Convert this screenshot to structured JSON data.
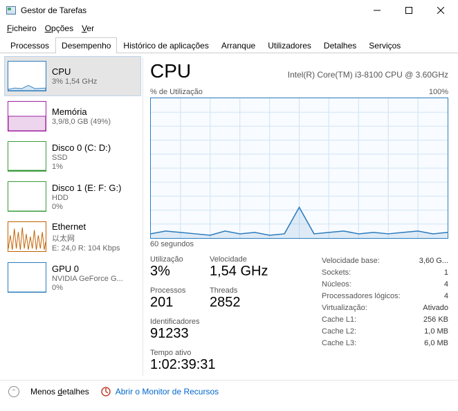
{
  "window": {
    "title": "Gestor de Tarefas"
  },
  "menu": {
    "file": "Ficheiro",
    "options": "Opções",
    "view": "Ver"
  },
  "tabs": [
    "Processos",
    "Desempenho",
    "Histórico de aplicações",
    "Arranque",
    "Utilizadores",
    "Detalhes",
    "Serviços"
  ],
  "active_tab_index": 1,
  "sidebar": [
    {
      "title": "CPU",
      "sub1": "3% 1,54 GHz",
      "sub2": "",
      "color": "#2a7bbd"
    },
    {
      "title": "Memória",
      "sub1": "3,9/8,0 GB (49%)",
      "sub2": "",
      "color": "#a020a0"
    },
    {
      "title": "Disco 0 (C: D:)",
      "sub1": "SSD",
      "sub2": "1%",
      "color": "#3a9a3a"
    },
    {
      "title": "Disco 1 (E: F: G:)",
      "sub1": "HDD",
      "sub2": "0%",
      "color": "#3a9a3a"
    },
    {
      "title": "Ethernet",
      "sub1": "以太网",
      "sub2": "E: 24,0 R: 104 Kbps",
      "color": "#c06000"
    },
    {
      "title": "GPU 0",
      "sub1": "NVIDIA GeForce G...",
      "sub2": "0%",
      "color": "#2a7bbd"
    }
  ],
  "main": {
    "title": "CPU",
    "model": "Intel(R) Core(TM) i3-8100 CPU @ 3.60GHz",
    "chart_label_left": "% de Utilização",
    "chart_label_right": "100%",
    "chart_bottom": "60 segundos",
    "stats": {
      "util_label": "Utilização",
      "util": "3%",
      "speed_label": "Velocidade",
      "speed": "1,54 GHz",
      "proc_label": "Processos",
      "proc": "201",
      "threads_label": "Threads",
      "threads": "2852",
      "handles_label": "Identificadores",
      "handles": "91233",
      "uptime_label": "Tempo ativo",
      "uptime": "1:02:39:31"
    },
    "info": [
      {
        "k": "Velocidade base:",
        "v": "3,60 G..."
      },
      {
        "k": "Sockets:",
        "v": "1"
      },
      {
        "k": "Núcleos:",
        "v": "4"
      },
      {
        "k": "Processadores lógicos:",
        "v": "4"
      },
      {
        "k": "Virtualização:",
        "v": "Ativado"
      },
      {
        "k": "Cache L1:",
        "v": "256 KB"
      },
      {
        "k": "Cache L2:",
        "v": "1,0 MB"
      },
      {
        "k": "Cache L3:",
        "v": "6,0 MB"
      }
    ]
  },
  "footer": {
    "less": "Menos detalhes",
    "resmon": "Abrir o Monitor de Recursos"
  },
  "chart_data": {
    "type": "line",
    "title": "% de Utilização",
    "xlabel": "60 segundos",
    "ylabel": "% de Utilização",
    "ylim": [
      0,
      100
    ],
    "x_seconds": [
      60,
      57,
      54,
      51,
      48,
      45,
      42,
      39,
      36,
      33,
      30,
      27,
      24,
      21,
      18,
      15,
      12,
      9,
      6,
      3,
      0
    ],
    "values": [
      3,
      5,
      4,
      3,
      2,
      5,
      3,
      4,
      2,
      3,
      22,
      3,
      4,
      5,
      3,
      4,
      3,
      4,
      5,
      3,
      4
    ]
  }
}
